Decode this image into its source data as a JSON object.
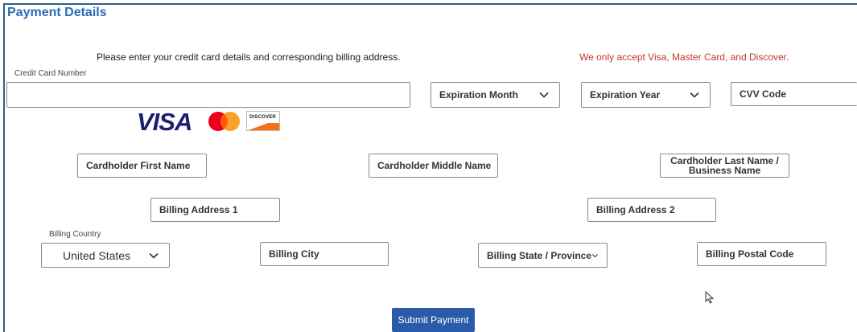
{
  "header": {
    "title": "Payment Details"
  },
  "instructions": "Please enter your credit card details and corresponding billing address.",
  "accepted_cards_notice": "We only accept Visa, Master Card, and Discover.",
  "card": {
    "number_label": "Credit Card Number",
    "number_value": "",
    "expiration_month": "Expiration Month",
    "expiration_year": "Expiration Year",
    "cvv_placeholder": "CVV Code",
    "logos": {
      "visa": "VISA",
      "discover": "DISCOVER"
    }
  },
  "cardholder": {
    "first_name_placeholder": "Cardholder First Name",
    "middle_name_placeholder": "Cardholder Middle Name",
    "last_name_placeholder": "Cardholder Last Name / Business Name"
  },
  "billing": {
    "address1_placeholder": "Billing Address 1",
    "address2_placeholder": "Billing Address 2",
    "country_label": "Billing Country",
    "country_value": "United States",
    "city_placeholder": "Billing City",
    "state_value": "Billing State / Province",
    "postal_placeholder": "Billing Postal Code"
  },
  "submit_label": "Submit Payment",
  "colors": {
    "title": "#2b6cb3",
    "notice": "#c0392b",
    "button": "#2b5aa8",
    "visa": "#1a1f71",
    "mastercard_red": "#eb001b",
    "mastercard_orange": "#f79e1b",
    "discover_orange": "#f47216"
  }
}
